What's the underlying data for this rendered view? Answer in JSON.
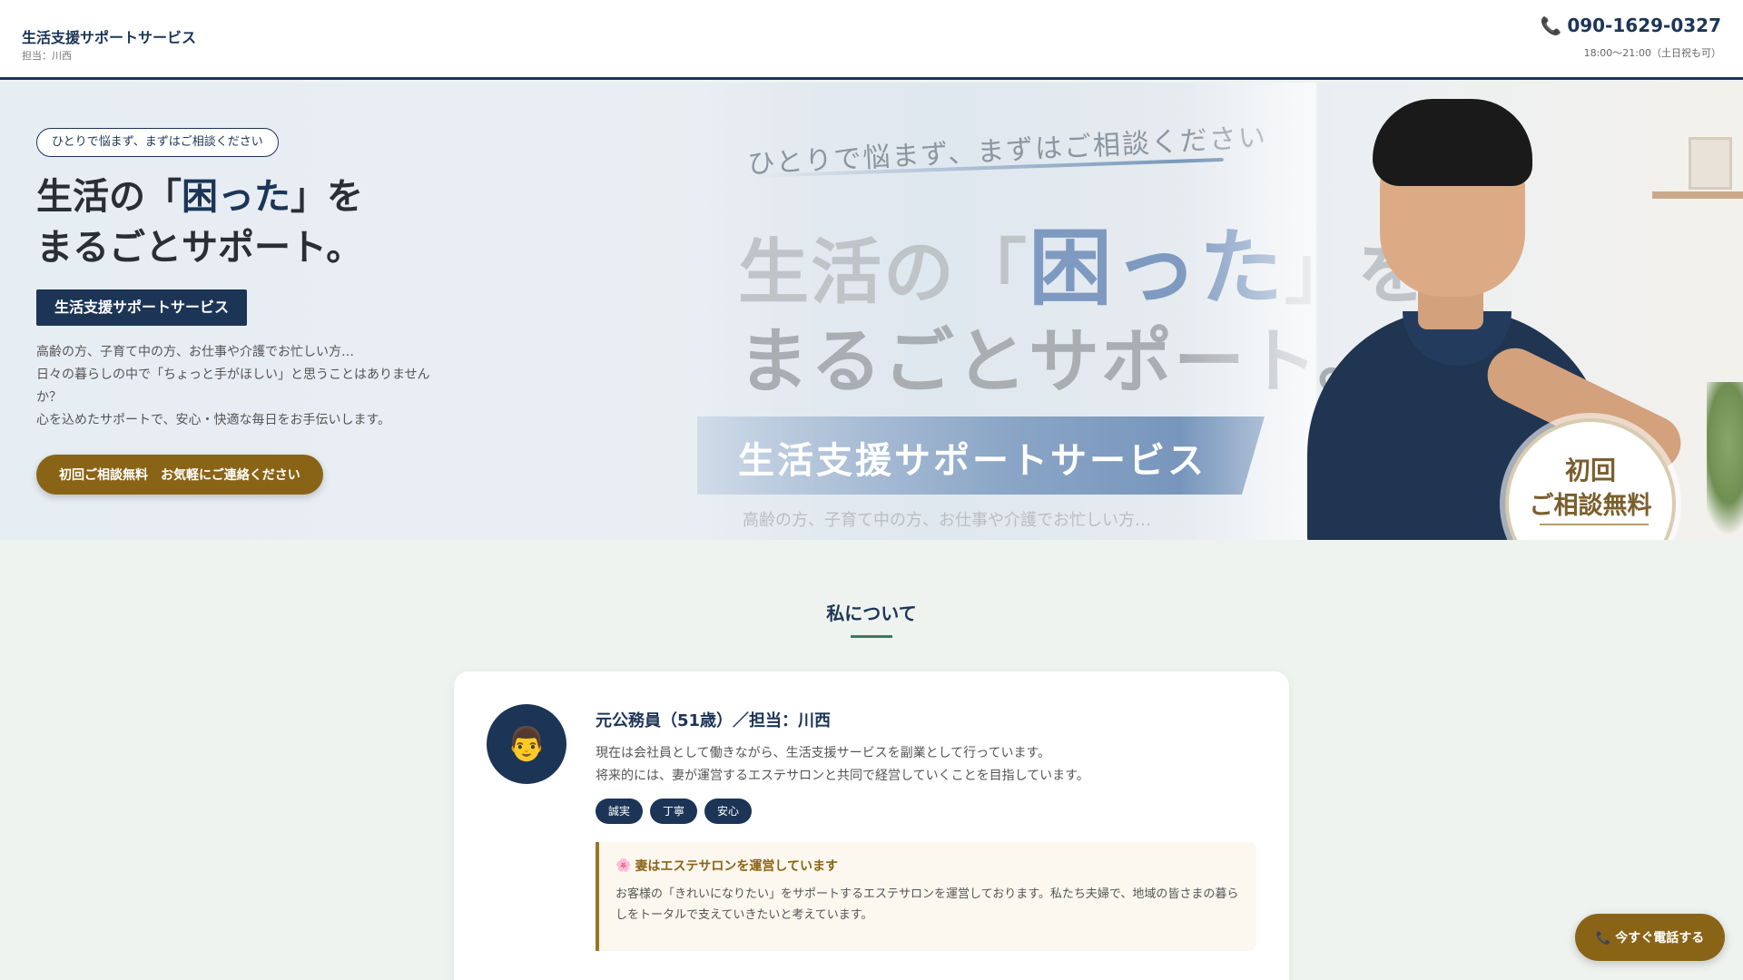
{
  "header": {
    "title": "生活支援サポートサービス",
    "subtitle": "担当：川西",
    "phone": "090-1629-0327",
    "hours": "18:00〜21:00（土日祝も可）"
  },
  "hero": {
    "pill": "ひとりで悩まず、まずはご相談ください",
    "title_line1_pre": "生活の「",
    "title_highlight": "困った",
    "title_line1_post": "」を",
    "title_line2": "まるごとサポート。",
    "service_label": "生活支援サポートサービス",
    "desc": [
      "高齢の方、子育て中の方、お仕事や介護でお忙しい方…",
      "日々の暮らしの中で「ちょっと手がほしい」と思うことはありません",
      "か？",
      "心を込めたサポートで、安心・快適な毎日をお手伝いします。"
    ],
    "cta": "初回ご相談無料　お気軽にご連絡ください",
    "art": {
      "tagline": "ひとりで悩まず、まずはご相談ください",
      "line1_pre": "生活の「",
      "line1_em": "困った",
      "line1_post": "」を",
      "line2": "まるごとサポート。",
      "band": "生活支援サポートサービス",
      "sub": "高齢の方、子育て中の方、お仕事や介護でお忙しい方…",
      "badge_l1": "初回",
      "badge_l2": "ご相談無料"
    }
  },
  "about": {
    "title": "私について",
    "profile_title": "元公務員（51歳）／担当：川西",
    "avatar": "👨",
    "desc": [
      "現在は会社員として働きながら、生活支援サービスを副業として行っています。",
      "将来的には、妻が運営するエステサロンと共同で経営していくことを目指しています。"
    ],
    "tags": [
      "誠実",
      "丁寧",
      "安心"
    ],
    "note_icon": "🌸",
    "note_title": "妻はエステサロンを運営しています",
    "note_body": "お客様の「きれいになりたい」をサポートするエステサロンを運営しております。私たち夫婦で、地域の皆さまの暮らしをトータルで支えていきたいと考えています。"
  },
  "floating": {
    "icon": "📞",
    "label": "今すぐ電話する"
  },
  "icons": {
    "phone": "phone-icon",
    "avatar": "man-avatar-icon",
    "flower": "flower-icon"
  },
  "colors": {
    "navy": "#1c3557",
    "gold": "#8a6416",
    "green": "#3d7a5c",
    "bg": "#eef3ef"
  }
}
